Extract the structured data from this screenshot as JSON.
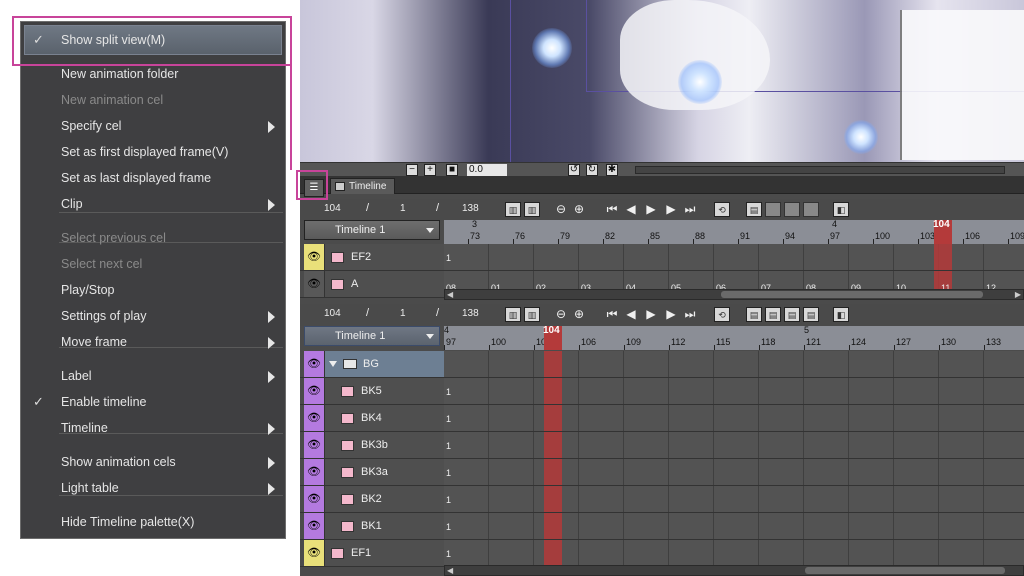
{
  "canvas_bar": {
    "zoom_value": "0.0"
  },
  "palette": {
    "tab_label": "Timeline",
    "upper": {
      "current_frame": "104",
      "slash1": "/",
      "mid_value": "1",
      "slash2": "/",
      "total_frames": "138",
      "timeline_name": "Timeline 1",
      "ruler_labels": [
        "73",
        "76",
        "79",
        "82",
        "85",
        "88",
        "91",
        "94",
        "97",
        "100",
        "103",
        "106",
        "109"
      ],
      "second_marks": [
        {
          "label": "3"
        },
        {
          "label": "4"
        }
      ],
      "cursor_label": "104",
      "tracks": [
        {
          "name": "EF2",
          "first_cell": "1"
        },
        {
          "name": "A",
          "cells": [
            "08",
            "01",
            "02",
            "03",
            "04",
            "05",
            "06",
            "07",
            "08",
            "09",
            "10",
            "11",
            "12",
            "13"
          ]
        }
      ]
    },
    "lower": {
      "current_frame": "104",
      "slash1": "/",
      "mid_value": "1",
      "slash2": "/",
      "total_frames": "138",
      "timeline_name": "Timeline 1",
      "ruler_labels": [
        "97",
        "100",
        "103",
        "106",
        "109",
        "112",
        "115",
        "118",
        "121",
        "124",
        "127",
        "130",
        "133"
      ],
      "second_marks": [
        {
          "label": "4"
        },
        {
          "label": "5"
        }
      ],
      "cursor_label": "104",
      "tracks": [
        {
          "name": "BG",
          "type": "folder"
        },
        {
          "name": "BK5",
          "first_cell": "1"
        },
        {
          "name": "BK4",
          "first_cell": "1"
        },
        {
          "name": "BK3b",
          "first_cell": "1"
        },
        {
          "name": "BK3a",
          "first_cell": "1"
        },
        {
          "name": "BK2",
          "first_cell": "1"
        },
        {
          "name": "BK1",
          "first_cell": "1"
        },
        {
          "name": "EF1",
          "first_cell": "1"
        }
      ]
    }
  },
  "menu": {
    "items": [
      {
        "label": "Show split view(M)",
        "checked": true,
        "highlighted": true
      },
      {
        "label": "New animation folder"
      },
      {
        "label": "New animation cel",
        "disabled": true
      },
      {
        "label": "Specify cel",
        "submenu": true
      },
      {
        "label": "Set as first displayed frame(V)"
      },
      {
        "label": "Set as last displayed frame"
      },
      {
        "label": "Clip",
        "submenu": true
      },
      {
        "label": "Select previous cel",
        "disabled": true
      },
      {
        "label": "Select next cel",
        "disabled": true
      },
      {
        "label": "Play/Stop"
      },
      {
        "label": "Settings of play",
        "submenu": true
      },
      {
        "label": "Move frame",
        "submenu": true
      },
      {
        "label": "Label",
        "submenu": true
      },
      {
        "label": "Enable timeline",
        "checked": true
      },
      {
        "label": "Timeline",
        "submenu": true
      },
      {
        "label": "Show animation cels",
        "submenu": true
      },
      {
        "label": "Light table",
        "submenu": true
      },
      {
        "label": "Hide Timeline palette(X)"
      }
    ],
    "check_glyph": "✓"
  },
  "icons": {
    "eye": "👁"
  },
  "colors": {
    "callout": "#c8449a",
    "cursor_band": "#b43a3a",
    "eye_yellow": "#e9e07a",
    "eye_purple": "#b47ae0"
  }
}
